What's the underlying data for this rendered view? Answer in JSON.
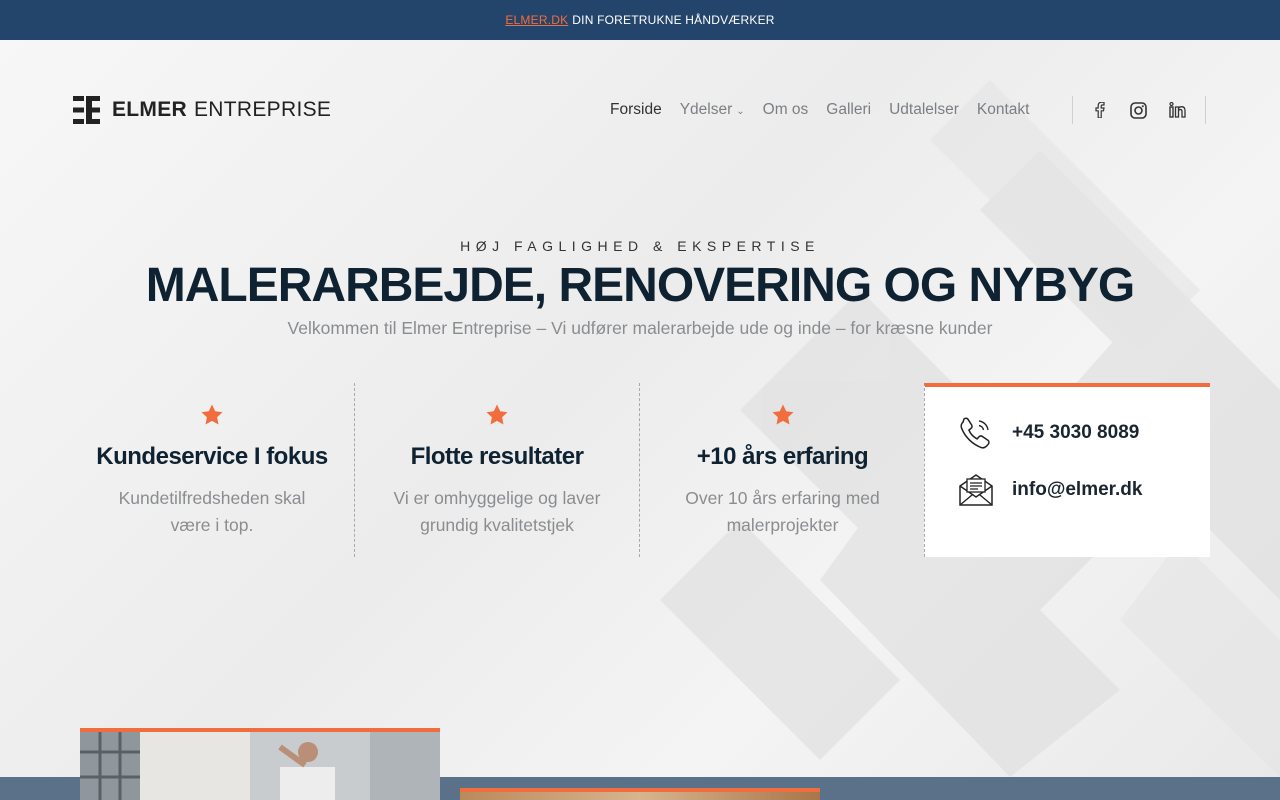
{
  "topbar": {
    "link_label": "ELMER.DK",
    "text": "DIN FORETRUKNE HÅNDVÆRKER"
  },
  "logo": {
    "bold": "ELMER",
    "light": "ENTREPRISE"
  },
  "nav": {
    "items": [
      {
        "label": "Forside",
        "active": true
      },
      {
        "label": "Ydelser",
        "has_dropdown": true
      },
      {
        "label": "Om os"
      },
      {
        "label": "Galleri"
      },
      {
        "label": "Udtalelser"
      },
      {
        "label": "Kontakt"
      }
    ],
    "socials": [
      "facebook-icon",
      "instagram-icon",
      "linkedin-icon"
    ]
  },
  "hero": {
    "eyebrow": "HØJ FAGLIGHED & EKSPERTISE",
    "title": "MALERARBEJDE, RENOVERING OG NYBYG",
    "subtitle": "Velkommen til Elmer Entreprise – Vi udfører malerarbejde ude og inde – for kræsne kunder"
  },
  "features": [
    {
      "title": "Kundeservice I fokus",
      "text": "Kundetilfredsheden skal være i top."
    },
    {
      "title": "Flotte resultater",
      "text": "Vi er omhyggelige og laver grundig kvalitetstjek"
    },
    {
      "title": "+10 års erfaring",
      "text": "Over 10 års erfaring med malerprojekter"
    }
  ],
  "contact": {
    "phone": "+45 3030 8089",
    "email": "info@elmer.dk"
  },
  "colors": {
    "accent": "#f26d3d",
    "topbar": "#23456b",
    "heading": "#0f2231"
  }
}
